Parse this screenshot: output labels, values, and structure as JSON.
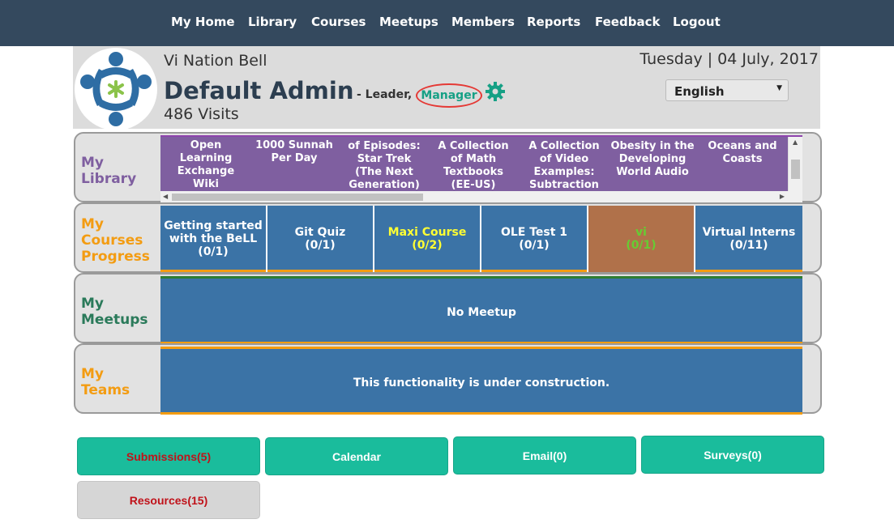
{
  "nav": {
    "items": [
      "My Home",
      "Library",
      "Courses",
      "Meetups",
      "Members",
      "Reports",
      "Feedback",
      "Logout"
    ]
  },
  "header": {
    "nation": "Vi Nation Bell",
    "user_name": "Default Admin",
    "role_prefix": "- Leader,",
    "role_highlight": "Manager",
    "visits": "486 Visits",
    "date": "Tuesday | 04 July, 2017",
    "language": "English"
  },
  "library": {
    "label_line1": "My",
    "label_line2": "Library",
    "items": [
      "Open Learning Exchange Wiki",
      "1000 Sunnah Per Day",
      "of Episodes: Star Trek (The Next Generation)",
      "A Collection of Math Textbooks (EE-US)",
      "A Collection of Video Examples: Subtraction",
      "Obesity in the Developing World Audio",
      "Oceans and Coasts"
    ]
  },
  "courses": {
    "label_line1": "My",
    "label_line2": "Courses",
    "label_line3": "Progress",
    "items": [
      {
        "title": "Getting started with the BeLL",
        "progress": "(0/1)"
      },
      {
        "title": "Git Quiz",
        "progress": "(0/1)"
      },
      {
        "title": "Maxi Course",
        "progress": "(0/2)"
      },
      {
        "title": "OLE Test 1",
        "progress": "(0/1)"
      },
      {
        "title": "vi",
        "progress": "(0/1)"
      },
      {
        "title": "Virtual Interns",
        "progress": "(0/11)"
      }
    ]
  },
  "meetups": {
    "label_line1": "My",
    "label_line2": "Meetups",
    "message": "No Meetup"
  },
  "teams": {
    "label_line1": "My",
    "label_line2": "Teams",
    "message": "This functionality is under construction."
  },
  "buttons": {
    "submissions": "Submissions(5)",
    "calendar": "Calendar",
    "email": "Email(0)",
    "surveys": "Surveys(0)",
    "resources": "Resources(15)"
  },
  "colors": {
    "nav_bg": "#34495e",
    "accent_green": "#1abc9c",
    "library_purple": "#7f5fa0",
    "tile_blue": "#3b73a6",
    "highlight_brown": "#b0714a",
    "orange": "#f39c12"
  },
  "icons": {
    "settings": "gear-icon",
    "language_dropdown": "chevron-down-icon"
  }
}
